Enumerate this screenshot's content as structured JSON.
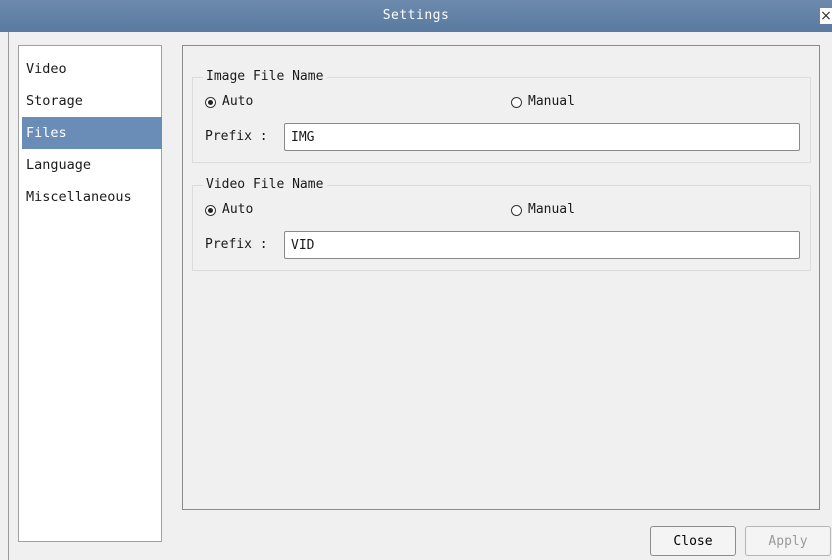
{
  "window": {
    "title": "Settings",
    "close_glyph": "×"
  },
  "sidebar": {
    "items": [
      {
        "label": "Video",
        "selected": false
      },
      {
        "label": "Storage",
        "selected": false
      },
      {
        "label": "Files",
        "selected": true
      },
      {
        "label": "Language",
        "selected": false
      },
      {
        "label": "Miscellaneous",
        "selected": false
      }
    ]
  },
  "image_file_name": {
    "title": "Image File Name",
    "auto_label": "Auto",
    "manual_label": "Manual",
    "selected": "Auto",
    "prefix_label": "Prefix :",
    "prefix_value": "IMG"
  },
  "video_file_name": {
    "title": "Video File Name",
    "auto_label": "Auto",
    "manual_label": "Manual",
    "selected": "Auto",
    "prefix_label": "Prefix :",
    "prefix_value": "VID"
  },
  "buttons": {
    "close_label": "Close",
    "apply_label": "Apply",
    "apply_enabled": false
  },
  "colors": {
    "titlebar": "#6280a6",
    "selected_item": "#6a8db8"
  }
}
